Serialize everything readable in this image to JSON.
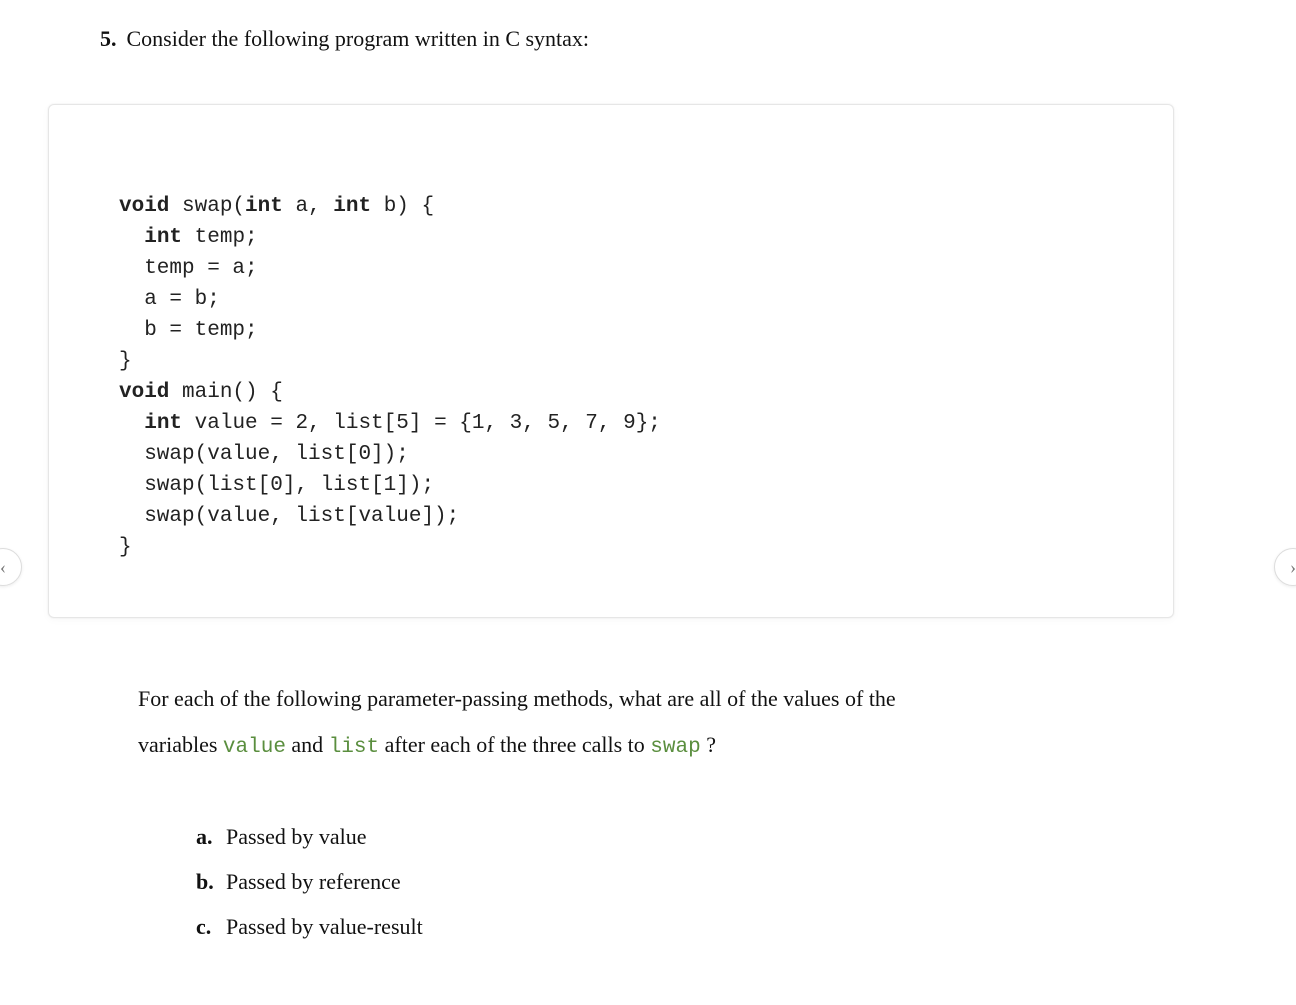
{
  "question": {
    "number": "5.",
    "prompt": "Consider the following program written in C syntax:"
  },
  "code": {
    "l1a": "void",
    "l1b": " swap(",
    "l1c": "int",
    "l1d": " a, ",
    "l1e": "int",
    "l1f": " b) {",
    "l2a": "  ",
    "l2b": "int",
    "l2c": " temp;",
    "l3": "  temp = a;",
    "l4": "  a = b;",
    "l5": "  b = temp;",
    "l6": "}",
    "l7a": "void",
    "l7b": " main() {",
    "l8a": "  ",
    "l8b": "int",
    "l8c": " value = 2, list[5] = {1, 3, 5, 7, 9};",
    "l9": "  swap(value, list[0]);",
    "l10": "  swap(list[0], list[1]);",
    "l11": "  swap(value, list[value]);",
    "l12": "}"
  },
  "body": {
    "t1": "For each of the following parameter-passing methods, what are all of the values of the",
    "t2a": "variables ",
    "t2_code1": "value",
    "t2b": " and ",
    "t2_code2": "list",
    "t2c": " after each of the three calls to ",
    "t2_code3": "swap",
    "t2d": " ?"
  },
  "options": [
    {
      "letter": "a.",
      "text": "Passed by value"
    },
    {
      "letter": "b.",
      "text": "Passed by reference"
    },
    {
      "letter": "c.",
      "text": "Passed by value-result"
    }
  ],
  "nav": {
    "prev": "‹",
    "next": "›"
  }
}
